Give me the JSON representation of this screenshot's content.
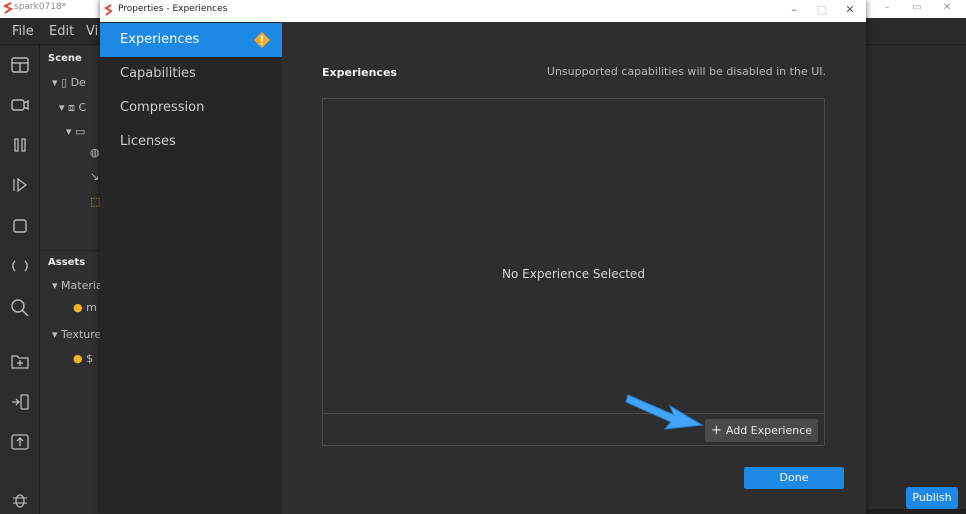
{
  "app": {
    "title": "spark0718*",
    "menu": [
      "File",
      "Edit",
      "Vi"
    ],
    "scene_header": "Scene",
    "scene_items": [
      "De",
      "C"
    ],
    "assets_header": "Assets",
    "asset_items": [
      "Materia",
      "m",
      "Texture",
      "$"
    ],
    "publish_label": "Publish"
  },
  "dialog": {
    "title": "Properties - Experiences",
    "window_controls": [
      "–",
      "□",
      "✕"
    ],
    "nav": [
      {
        "label": "Experiences",
        "active": true,
        "warning": true
      },
      {
        "label": "Capabilities",
        "active": false
      },
      {
        "label": "Compression",
        "active": false
      },
      {
        "label": "Licenses",
        "active": false
      }
    ],
    "section_title": "Experiences",
    "section_note": "Unsupported capabilities will be disabled in the UI.",
    "empty_text": "No Experience Selected",
    "add_button": {
      "icon": "+",
      "label": "Add Experience"
    },
    "done_label": "Done"
  },
  "colors": {
    "accent": "#1e88e5",
    "warning": "#f5a623",
    "callout": "#42a5f5"
  }
}
